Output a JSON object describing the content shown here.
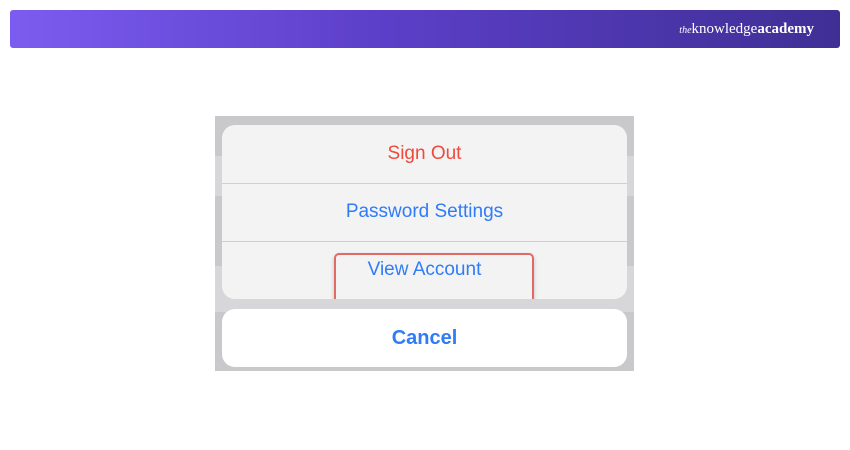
{
  "brand": {
    "prefix": "the",
    "word1": "knowledge",
    "word2": "academy"
  },
  "action_sheet": {
    "items": [
      {
        "label": "Sign Out",
        "style": "destructive"
      },
      {
        "label": "Password Settings",
        "style": "default"
      },
      {
        "label": "View Account",
        "style": "default",
        "highlighted": true
      }
    ],
    "cancel_label": "Cancel"
  },
  "colors": {
    "action_blue": "#2f7cf6",
    "destructive_red": "#ef4a3c",
    "highlight_border": "#e06a64",
    "banner_start": "#7b5cf0",
    "banner_end": "#3f2f95"
  }
}
